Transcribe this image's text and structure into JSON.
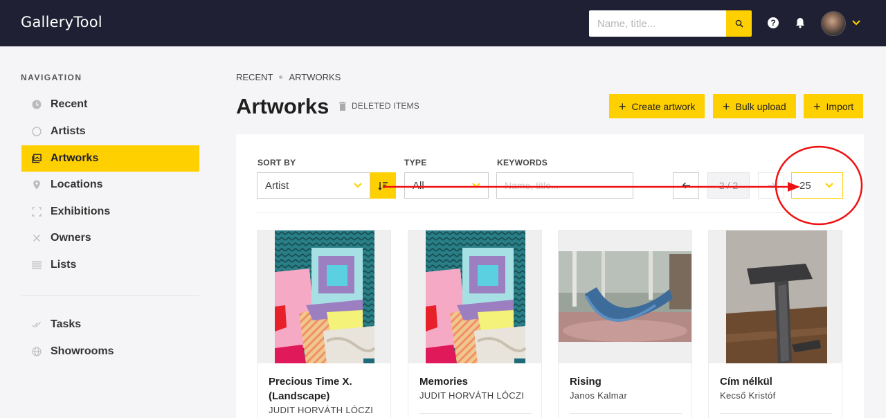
{
  "app": {
    "title": "GalleryTool",
    "search_placeholder": "Name, title..."
  },
  "sidebar": {
    "title": "NAVIGATION",
    "items": [
      {
        "label": "Recent",
        "icon": "clock-icon",
        "active": false
      },
      {
        "label": "Artists",
        "icon": "circle-icon",
        "active": false
      },
      {
        "label": "Artworks",
        "icon": "gallery-icon",
        "active": true
      },
      {
        "label": "Locations",
        "icon": "pin-icon",
        "active": false
      },
      {
        "label": "Exhibitions",
        "icon": "frame-icon",
        "active": false
      },
      {
        "label": "Owners",
        "icon": "x-icon",
        "active": false
      },
      {
        "label": "Lists",
        "icon": "list-icon",
        "active": false
      }
    ],
    "secondary_items": [
      {
        "label": "Tasks",
        "icon": "check-icon"
      },
      {
        "label": "Showrooms",
        "icon": "globe-icon"
      }
    ]
  },
  "breadcrumb": [
    "RECENT",
    "ARTWORKS"
  ],
  "page": {
    "title": "Artworks",
    "deleted_items": "DELETED ITEMS",
    "actions": [
      "Create artwork",
      "Bulk upload",
      "Import"
    ]
  },
  "filters": {
    "sort_by_label": "SORT BY",
    "sort_by_value": "Artist",
    "type_label": "TYPE",
    "type_value": "All",
    "keywords_label": "KEYWORDS",
    "keywords_placeholder": "Name, title...",
    "page_indicator": "2 / 2",
    "per_page": "25"
  },
  "cards": [
    {
      "title": "Precious Time X. (Landscape)",
      "artist": "JUDIT HORVÁTH LÓCZI"
    },
    {
      "title": "Memories",
      "artist": "JUDIT HORVÁTH LÓCZI"
    },
    {
      "title": "Rising",
      "artist": "Janos Kalmar"
    },
    {
      "title": "Cím nélkül",
      "artist": "Kecső Kristóf"
    }
  ],
  "colors": {
    "accent": "#ffd000",
    "topbar": "#1f2033",
    "annotation": "#ee1111"
  }
}
